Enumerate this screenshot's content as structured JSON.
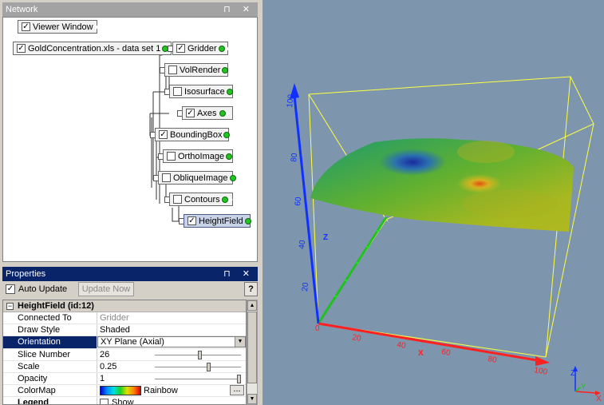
{
  "network": {
    "title": "Network",
    "title_buttons": "⊓ ✕",
    "modules": [
      {
        "id": "viewer",
        "label": "Viewer Window",
        "checked": true
      },
      {
        "id": "gold",
        "label": "GoldConcentration.xls - data set 1",
        "checked": true
      },
      {
        "id": "gridder",
        "label": "Gridder",
        "checked": true
      },
      {
        "id": "volrender",
        "label": "VolRender",
        "checked": false
      },
      {
        "id": "isosurface",
        "label": "Isosurface",
        "checked": false
      },
      {
        "id": "axes",
        "label": "Axes",
        "checked": true
      },
      {
        "id": "boundingbox",
        "label": "BoundingBox",
        "checked": true
      },
      {
        "id": "orthoimage",
        "label": "OrthoImage",
        "checked": false
      },
      {
        "id": "obliqueimage",
        "label": "ObliqueImage",
        "checked": false
      },
      {
        "id": "contours",
        "label": "Contours",
        "checked": false
      },
      {
        "id": "heightfield",
        "label": "HeightField",
        "checked": true
      }
    ]
  },
  "properties": {
    "title": "Properties",
    "auto_update_label": "Auto Update",
    "auto_update_checked": true,
    "update_now_label": "Update Now",
    "help_label": "?",
    "section_title": "HeightField (id:12)",
    "rows": [
      {
        "name": "Connected To",
        "value": "Gridder"
      },
      {
        "name": "Draw Style",
        "value": "Shaded"
      },
      {
        "name": "Orientation",
        "value": "XY Plane (Axial)"
      },
      {
        "name": "Slice Number",
        "value": "26",
        "slider": 0.52
      },
      {
        "name": "Scale",
        "value": "0.25",
        "slider": 0.63
      },
      {
        "name": "Opacity",
        "value": "1",
        "slider": 1.0
      },
      {
        "name": "ColorMap",
        "value": "Rainbow"
      }
    ],
    "legend_label": "Legend",
    "legend_show": "Show",
    "colormap_button": "..."
  },
  "viewport": {
    "axes": {
      "x_label": "X",
      "y_label": "Y",
      "z_label": "Z",
      "x_ticks": [
        "0",
        "20",
        "40",
        "60",
        "80",
        "100"
      ],
      "z_ticks": [
        "20",
        "40",
        "60",
        "80",
        "100"
      ],
      "mini_labels": [
        "Z",
        "Y",
        "X"
      ]
    },
    "colors": {
      "background": "#7d96ae",
      "x_axis": "#ff2020",
      "y_axis": "#20c020",
      "z_axis": "#1030ff",
      "box": "#ffff40"
    }
  }
}
